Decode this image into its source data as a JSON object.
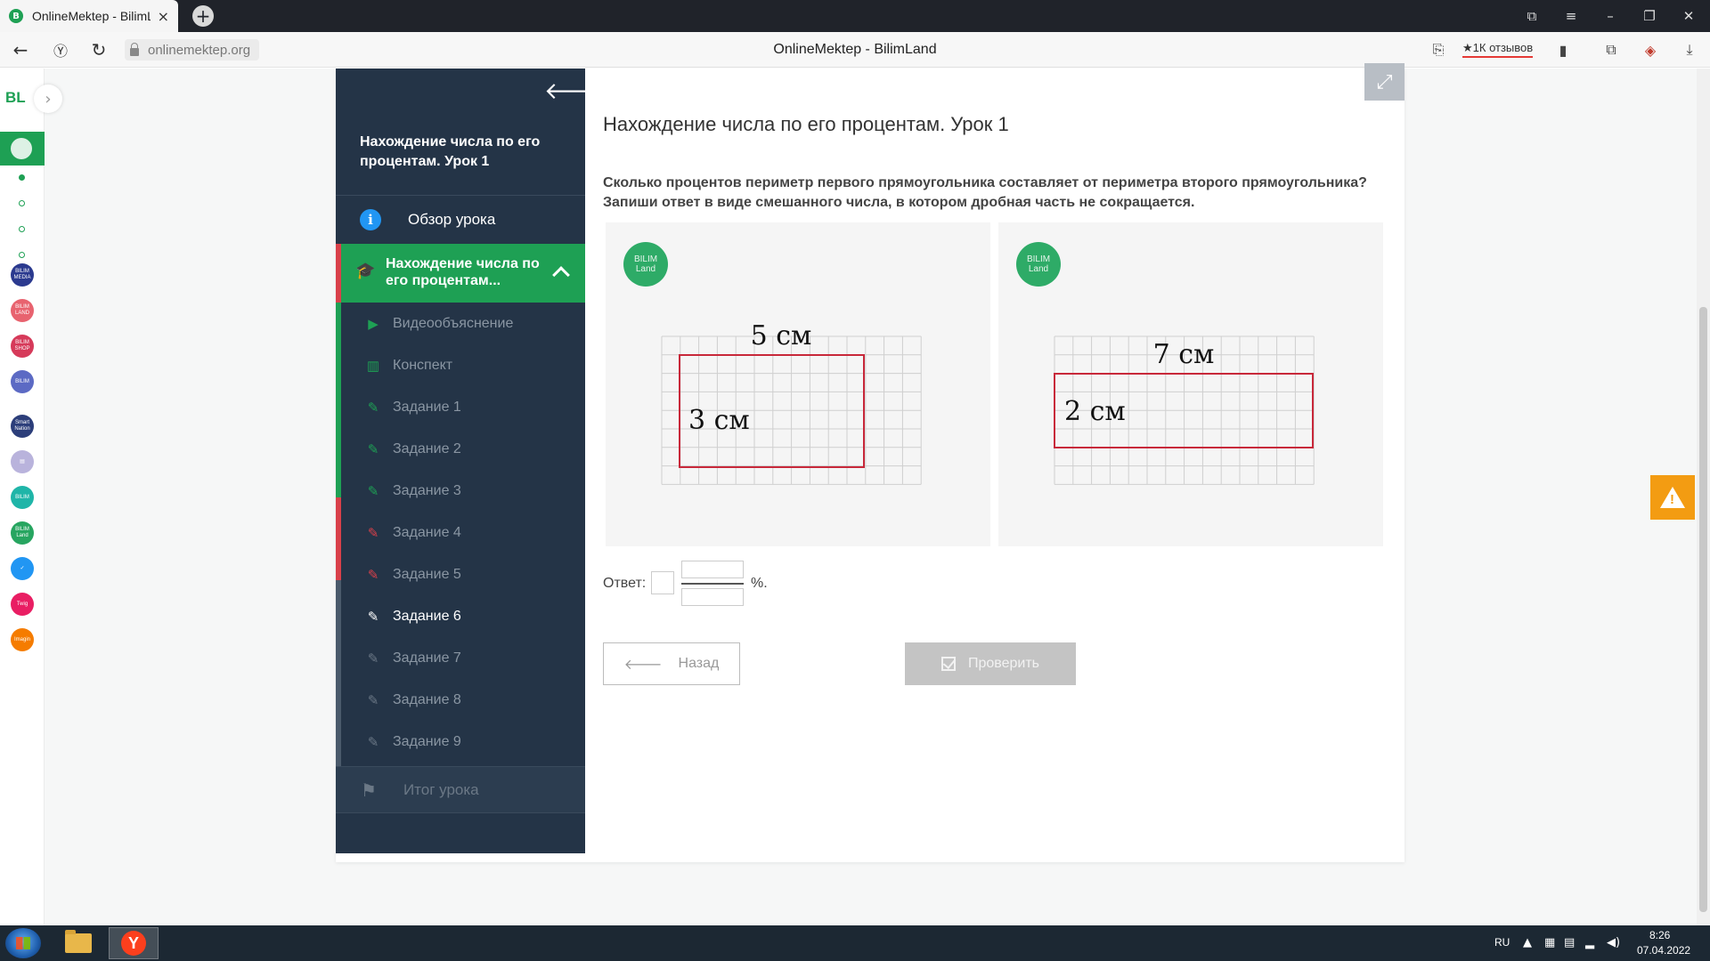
{
  "browser": {
    "tab_title": "OnlineMektep - BilimLand",
    "tab_favicon": "B",
    "url": "onlinemektep.org",
    "page_title": "OnlineMektep - BilimLand",
    "reviews_label": "★1К отзывов"
  },
  "rail": {
    "logo": "BL",
    "apps": [
      {
        "label": "BILIM MEDIA",
        "color": "#2b3a8f"
      },
      {
        "label": "BILIM LAND",
        "color": "#e8636f"
      },
      {
        "label": "BILIM SHOP",
        "color": "#d63a5a"
      },
      {
        "label": "BILIM",
        "color": "#5c6ac4"
      },
      {
        "label": "Smart Nation",
        "color": "#2c3e7a"
      },
      {
        "label": "▤",
        "color": "#b9b3dc"
      },
      {
        "label": "BILIM",
        "color": "#1fb5a8"
      },
      {
        "label": "BILIM Land",
        "color": "#27a560"
      },
      {
        "label": "✓",
        "color": "#2196f3"
      },
      {
        "label": "Twig",
        "color": "#e91e63"
      },
      {
        "label": "Imagin",
        "color": "#f57c00"
      }
    ]
  },
  "sidebar": {
    "title": "Нахождение числа по его процентам. Урок 1",
    "overview_label": "Обзор урока",
    "active_lesson_label": "Нахождение числа по его процентам...",
    "items": [
      {
        "label": "Видеообъяснение",
        "icon": "▶"
      },
      {
        "label": "Конспект",
        "icon": "▥"
      },
      {
        "label": "Задание 1",
        "icon": "✎"
      },
      {
        "label": "Задание 2",
        "icon": "✎"
      },
      {
        "label": "Задание 3",
        "icon": "✎"
      },
      {
        "label": "Задание 4",
        "icon": "✎"
      },
      {
        "label": "Задание 5",
        "icon": "✎"
      },
      {
        "label": "Задание 6",
        "icon": "✎"
      },
      {
        "label": "Задание 7",
        "icon": "✎"
      },
      {
        "label": "Задание 8",
        "icon": "✎"
      },
      {
        "label": "Задание 9",
        "icon": "✎"
      }
    ],
    "summary_label": "Итог урока"
  },
  "main": {
    "heading": "Нахождение числа по его процентам. Урок 1",
    "question": "Сколько процентов периметр первого прямоугольника составляет от периметра второго прямоугольника? Запиши ответ в виде смешанного числа, в котором дробная часть не сокращается.",
    "logo_text": "BILIM Land",
    "figures": [
      {
        "width_label": "5 см",
        "height_label": "3 см"
      },
      {
        "width_label": "7 см",
        "height_label": "2 см"
      }
    ],
    "answer_label": "Ответ:",
    "answer_suffix": "%.",
    "answer_whole": "",
    "answer_numerator": "",
    "answer_denominator": "",
    "back_button": "Назад",
    "check_button": "Проверить"
  },
  "taskbar": {
    "lang": "RU",
    "time": "8:26",
    "date": "07.04.2022"
  }
}
